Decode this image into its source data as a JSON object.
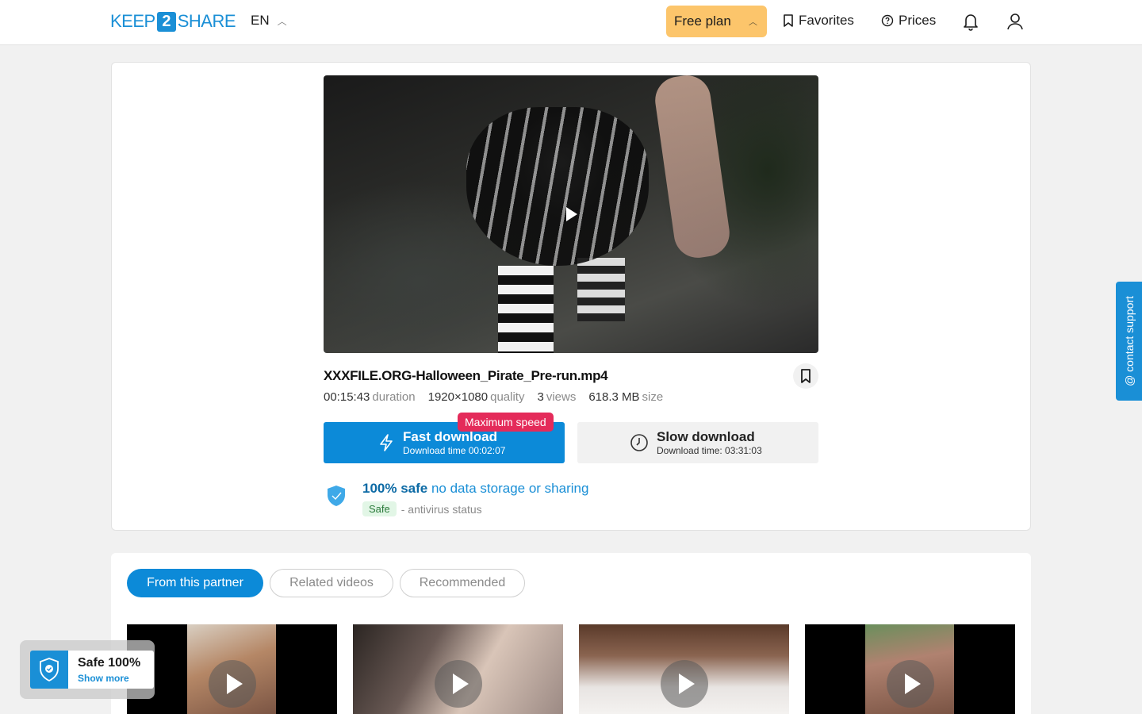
{
  "header": {
    "logo_left": "KEEP",
    "logo_mid": "2",
    "logo_right": "SHARE",
    "language": "EN",
    "plan_label": "Free plan",
    "favorites_label": "Favorites",
    "prices_label": "Prices"
  },
  "file": {
    "name": "XXXFILE.ORG-Halloween_Pirate_Pre-run.mp4",
    "duration_value": "00:15:43",
    "duration_unit": "duration",
    "quality_value": "1920×1080",
    "quality_unit": "quality",
    "views_value": "3",
    "views_unit": "views",
    "size_value": "618.3 MB",
    "size_unit": "size"
  },
  "download": {
    "fast_title": "Fast download",
    "fast_time": "Download time 00:02:07",
    "max_badge": "Maximum speed",
    "slow_title": "Slow download",
    "slow_time": "Download time: 03:31:03"
  },
  "safety": {
    "title_bold": "100% safe",
    "title_rest": "no data storage or sharing",
    "tag": "Safe",
    "status_text": "- antivirus status"
  },
  "tabs": [
    {
      "label": "From this partner",
      "active": true
    },
    {
      "label": "Related videos",
      "active": false
    },
    {
      "label": "Recommended",
      "active": false
    }
  ],
  "support_label": "@ contact support",
  "safe_widget": {
    "title": "Safe 100%",
    "link": "Show more"
  },
  "colors": {
    "brand": "#1a8fd6",
    "plan_bg": "#fcc56b",
    "badge": "#e42b5a"
  }
}
